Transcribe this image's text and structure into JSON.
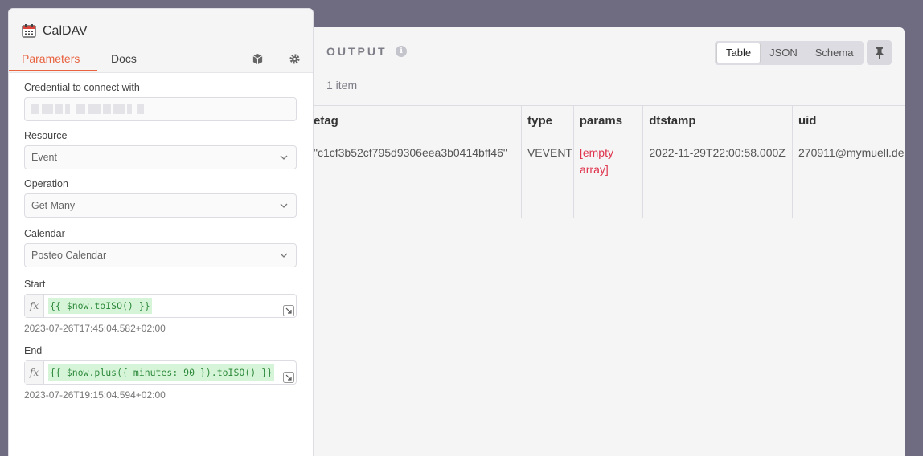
{
  "node": {
    "title": "CalDAV",
    "tabs": {
      "parameters": "Parameters",
      "docs": "Docs"
    }
  },
  "fields": {
    "credential": {
      "label": "Credential to connect with"
    },
    "resource": {
      "label": "Resource",
      "value": "Event"
    },
    "operation": {
      "label": "Operation",
      "value": "Get Many"
    },
    "calendar": {
      "label": "Calendar",
      "value": "Posteo Calendar"
    },
    "start": {
      "label": "Start",
      "fx": "fx",
      "expression": "{{ $now.toISO() }}",
      "hint": "2023-07-26T17:45:04.582+02:00"
    },
    "end": {
      "label": "End",
      "fx": "fx",
      "expression": "{{ $now.plus({ minutes: 90 }).toISO() }}",
      "hint": "2023-07-26T19:15:04.594+02:00"
    }
  },
  "output": {
    "title": "OUTPUT",
    "item_count": "1 item",
    "views": [
      "Table",
      "JSON",
      "Schema"
    ],
    "active_view": "Table",
    "columns": [
      "etag",
      "type",
      "params",
      "dtstamp",
      "uid"
    ],
    "rows": [
      {
        "etag": "\"c1cf3b52cf795d9306eea3b0414bff46\"",
        "type": "VEVENT",
        "params": "[empty array]",
        "dtstamp": "2022-11-29T22:00:58.000Z",
        "uid": "270911@mymuell.de"
      }
    ]
  },
  "colors": {
    "accent": "#e8633f",
    "backdrop": "#6f6b80",
    "code_bg": "#d6f5d8",
    "code_fg": "#2f8a3d",
    "empty_array": "#e0334b"
  }
}
